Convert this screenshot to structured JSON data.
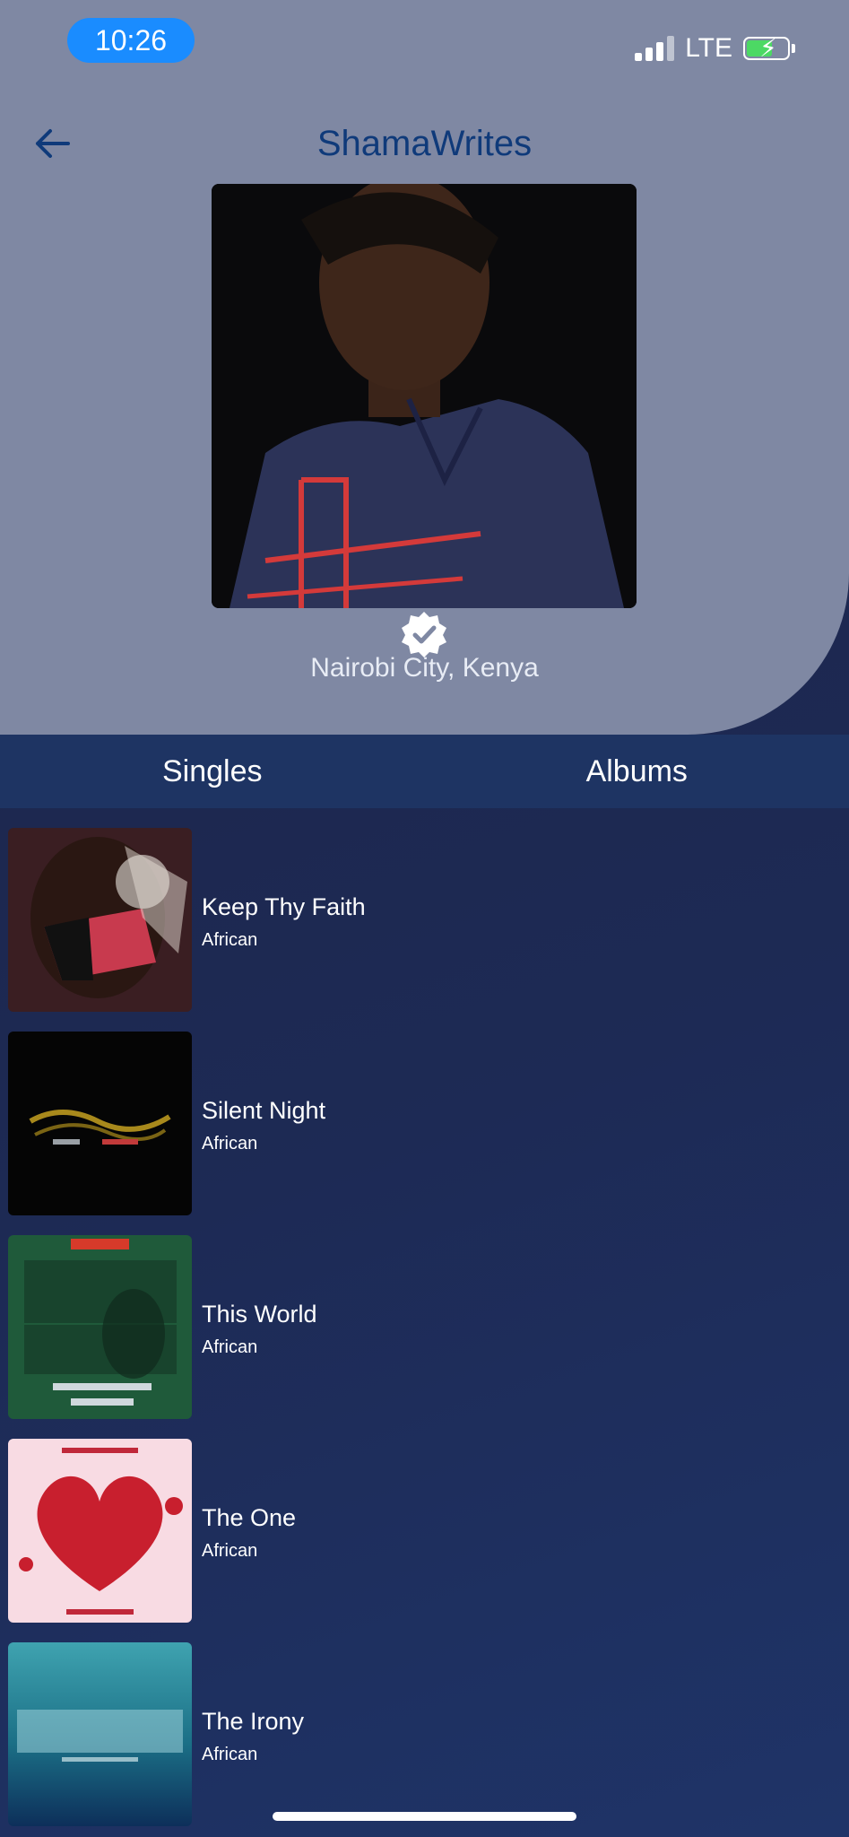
{
  "status": {
    "time": "10:26",
    "network": "LTE"
  },
  "header": {
    "title": "ShamaWrites",
    "location": "Nairobi City, Kenya"
  },
  "tabs": [
    {
      "label": "Singles"
    },
    {
      "label": "Albums"
    }
  ],
  "singles": [
    {
      "title": "Keep Thy Faith",
      "genre": "African",
      "art": "keep-thy-faith-cover"
    },
    {
      "title": "Silent Night",
      "genre": "African",
      "art": "silent-night-cover"
    },
    {
      "title": "This World",
      "genre": "African",
      "art": "this-world-cover"
    },
    {
      "title": "The One",
      "genre": "African",
      "art": "the-one-cover"
    },
    {
      "title": "The Irony",
      "genre": "African",
      "art": "the-irony-cover"
    }
  ],
  "colors": {
    "accent": "#1a8cff",
    "title": "#0f3a7a",
    "header_bg": "#7f88a3",
    "tabs_bg": "#1e3463"
  }
}
